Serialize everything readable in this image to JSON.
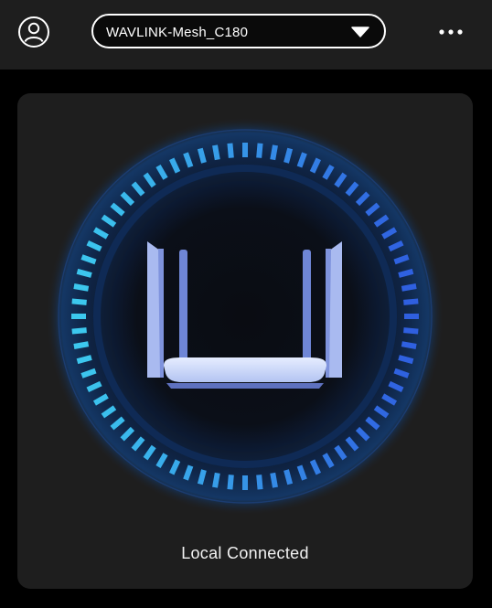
{
  "header": {
    "account_icon": "account-circle-icon",
    "network_selector": {
      "selected_network": "WAVLINK-Mesh_C180",
      "dropdown_icon": "triangle-down-icon"
    },
    "more_icon": "more-horizontal-icon"
  },
  "status_card": {
    "device_icon": "router-icon",
    "status_text": "Local Connected"
  },
  "colors": {
    "background": "#000000",
    "header_background": "#1e1e1e",
    "card_background": "#1e1e1e",
    "ring_cyan": "#3cc8ee",
    "ring_blue": "#2f5fe0",
    "router_body": "#b9c8f5",
    "router_antenna": "#7f93dd"
  }
}
